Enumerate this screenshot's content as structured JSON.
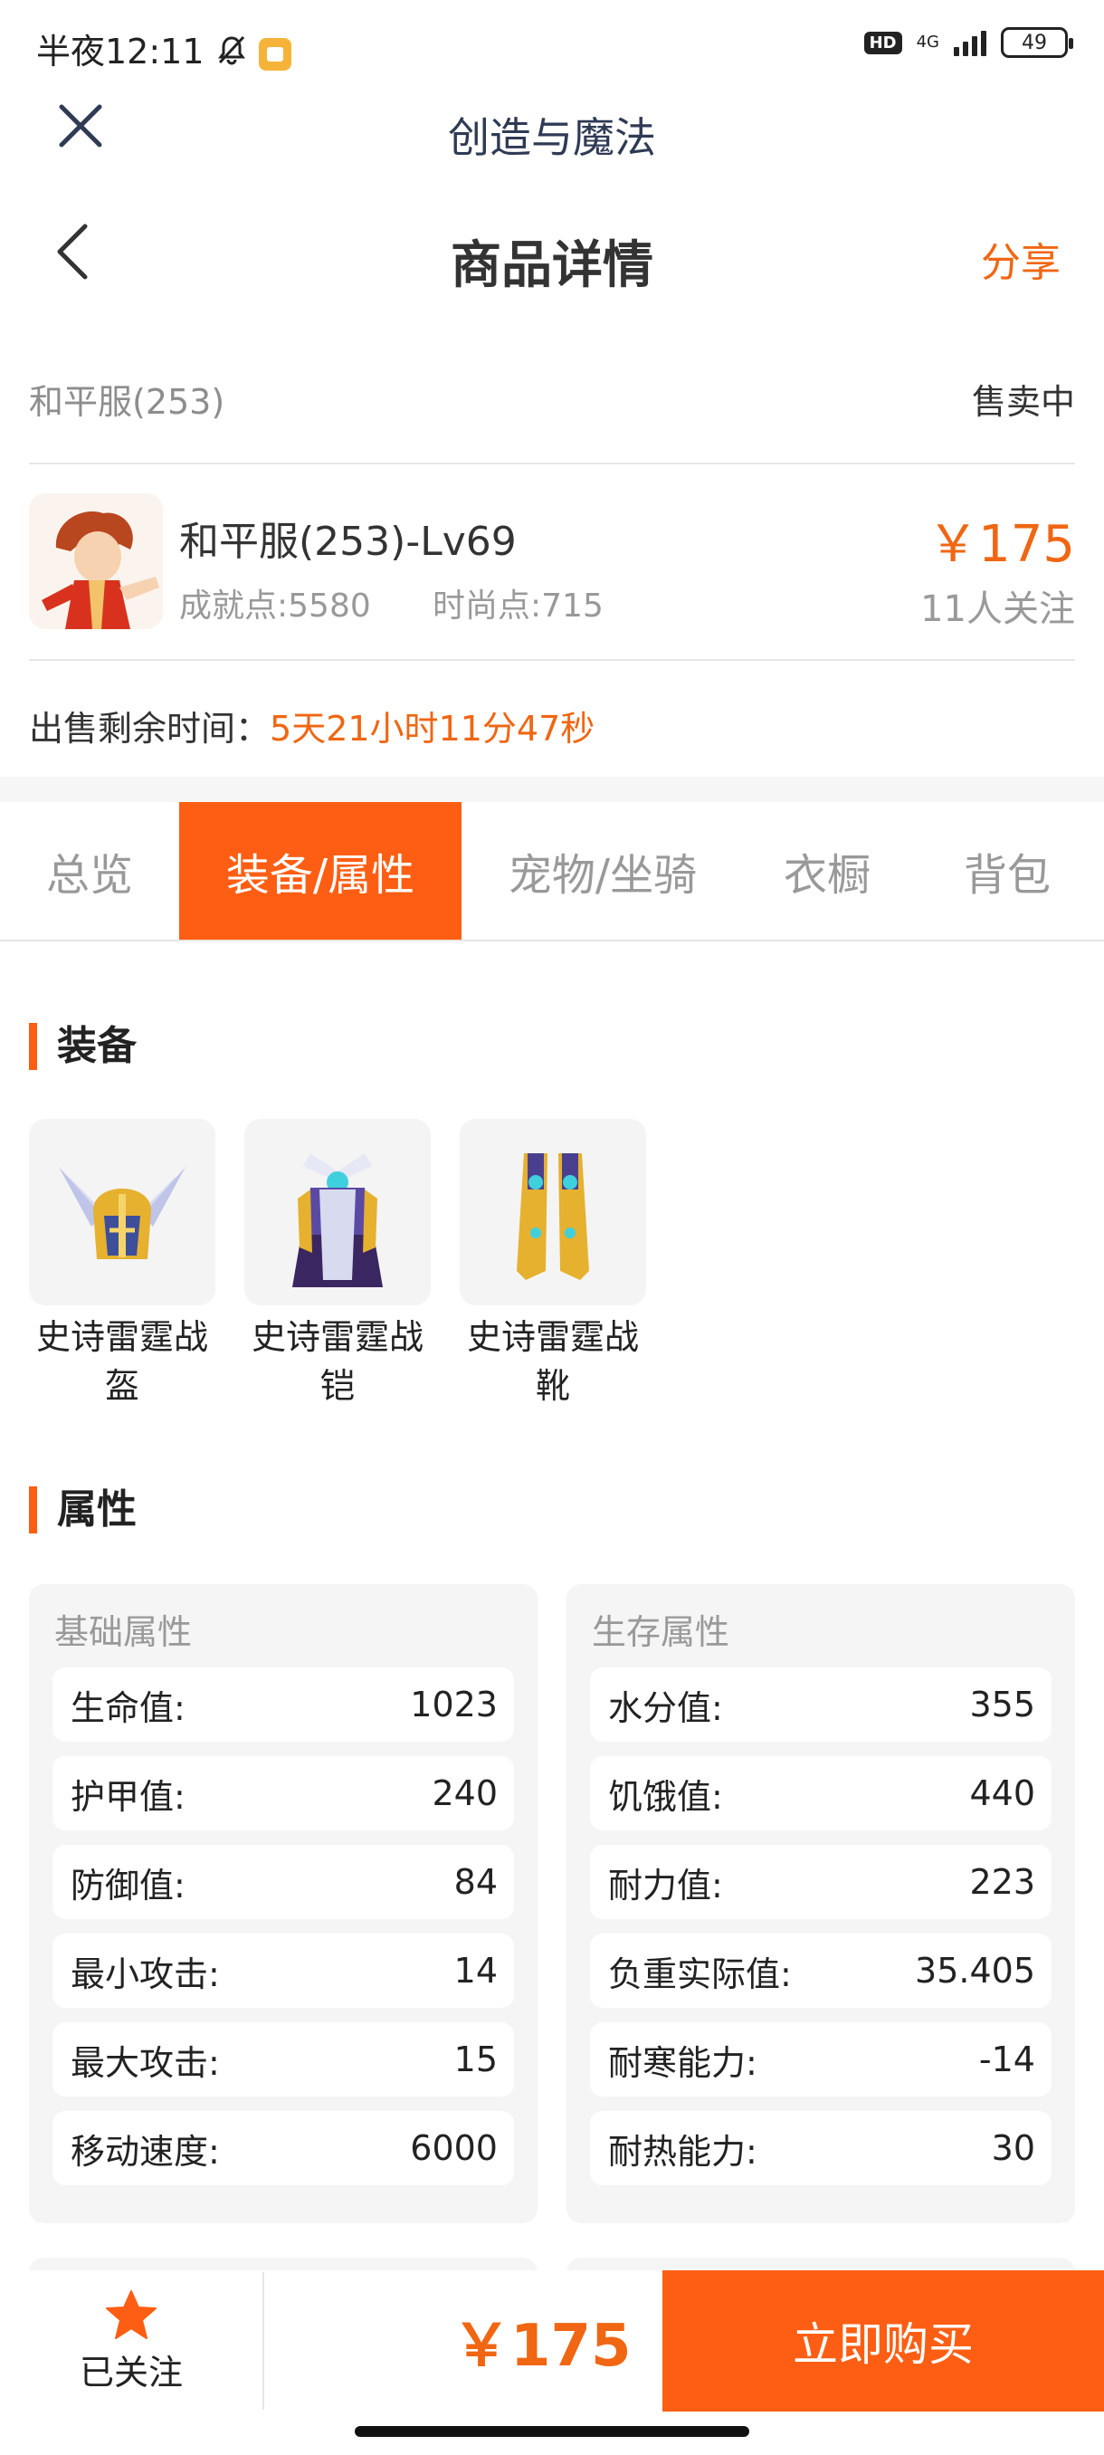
{
  "status_bar": {
    "time": "半夜12:11",
    "hd": "HD",
    "network": "4G",
    "battery": "49"
  },
  "mini_app": {
    "title": "创造与魔法"
  },
  "header": {
    "title": "商品详情",
    "share_label": "分享"
  },
  "item": {
    "server": "和平服(253)",
    "sale_status": "售卖中",
    "name": "和平服(253)-Lv69",
    "achievement": "成就点:5580",
    "fashion": "时尚点:715",
    "price": "￥175",
    "followers": "11人关注",
    "remaining_label": "出售剩余时间：",
    "remaining_value": "5天21小时11分47秒"
  },
  "tabs": [
    {
      "label": "总览",
      "active": false
    },
    {
      "label": "装备/属性",
      "active": true
    },
    {
      "label": "宠物/坐骑",
      "active": false
    },
    {
      "label": "衣橱",
      "active": false
    },
    {
      "label": "背包",
      "active": false
    }
  ],
  "equipment": {
    "title": "装备",
    "items": [
      {
        "name": "史诗雷霆战盔"
      },
      {
        "name": "史诗雷霆战铠"
      },
      {
        "name": "史诗雷霆战靴"
      }
    ]
  },
  "attributes": {
    "title": "属性",
    "basic": {
      "title": "基础属性",
      "rows": [
        {
          "label": "生命值:",
          "value": "1023"
        },
        {
          "label": "护甲值:",
          "value": "240"
        },
        {
          "label": "防御值:",
          "value": "84"
        },
        {
          "label": "最小攻击:",
          "value": "14"
        },
        {
          "label": "最大攻击:",
          "value": "15"
        },
        {
          "label": "移动速度:",
          "value": "6000"
        }
      ]
    },
    "survival": {
      "title": "生存属性",
      "rows": [
        {
          "label": "水分值:",
          "value": "355"
        },
        {
          "label": "饥饿值:",
          "value": "440"
        },
        {
          "label": "耐力值:",
          "value": "223"
        },
        {
          "label": "负重实际值:",
          "value": "35.405"
        },
        {
          "label": "耐寒能力:",
          "value": "-14"
        },
        {
          "label": "耐热能力:",
          "value": "30"
        }
      ]
    }
  },
  "bottom_bar": {
    "follow_label": "已关注",
    "price": "￥175",
    "buy_label": "立即购买"
  },
  "colors": {
    "accent": "#fe5e13",
    "price": "#f06612"
  }
}
